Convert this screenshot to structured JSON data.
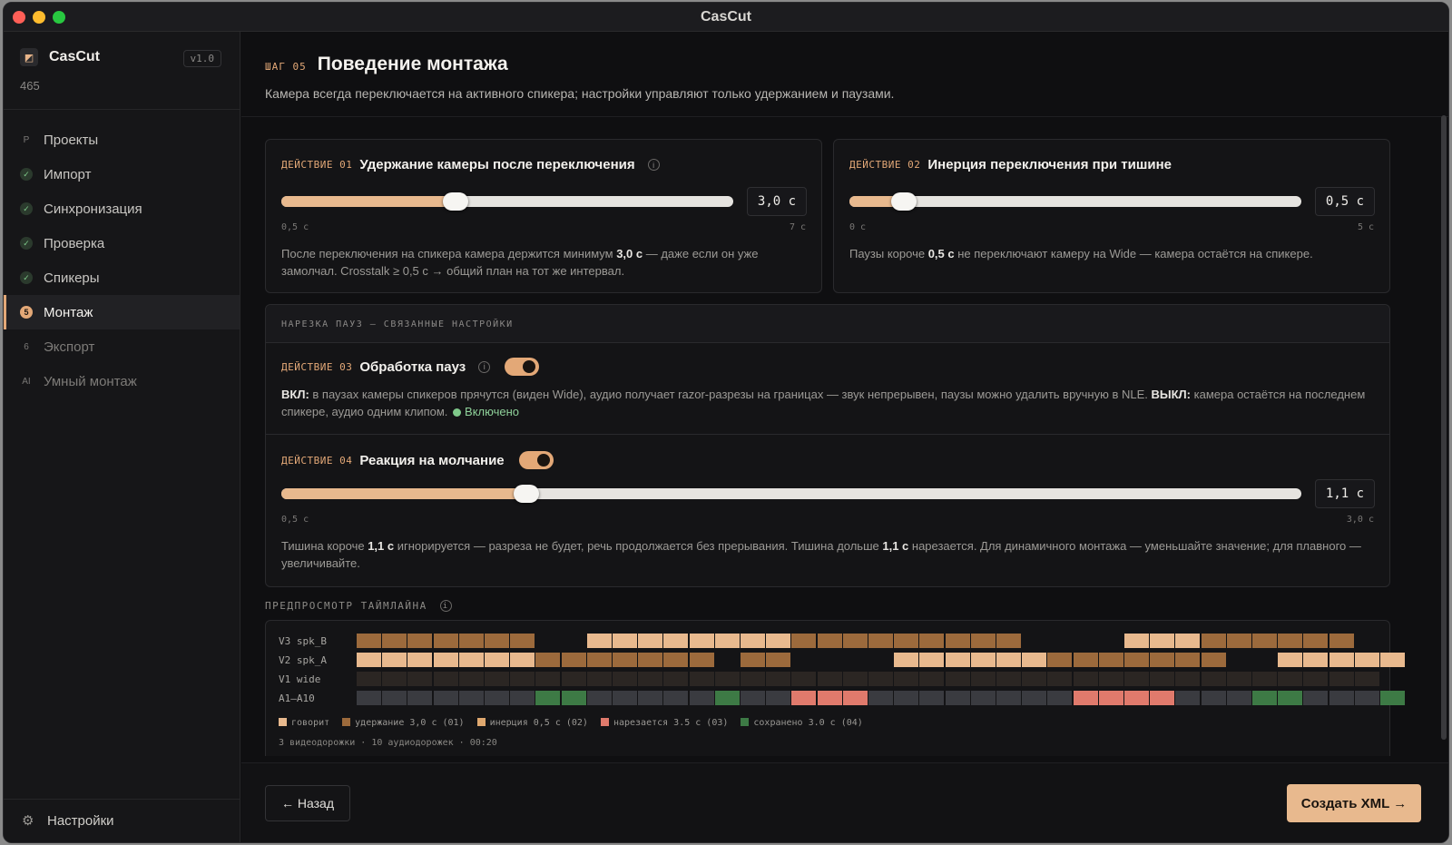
{
  "window": {
    "title": "CasCut"
  },
  "brand": {
    "name": "CasCut",
    "version": "v1.0",
    "subtitle": "465",
    "logo_icon": "clapper-icon"
  },
  "sidebar": {
    "items": [
      {
        "label": "Проекты",
        "icon": "P",
        "state": "pending"
      },
      {
        "label": "Импорт",
        "icon": "✓",
        "state": "done"
      },
      {
        "label": "Синхронизация",
        "icon": "✓",
        "state": "done"
      },
      {
        "label": "Проверка",
        "icon": "✓",
        "state": "done"
      },
      {
        "label": "Спикеры",
        "icon": "✓",
        "state": "done"
      },
      {
        "label": "Монтаж",
        "icon": "5",
        "state": "active"
      },
      {
        "label": "Экспорт",
        "icon": "6",
        "state": "pending"
      },
      {
        "label": "Умный монтаж",
        "icon": "AI",
        "state": "pending"
      }
    ],
    "settings_label": "Настройки"
  },
  "header": {
    "step_tag": "ШАГ 05",
    "title": "Поведение монтажа",
    "description": "Камера всегда переключается на активного спикера; настройки управляют только удержанием и паузами."
  },
  "action1": {
    "tag": "ДЕЙСТВИЕ 01",
    "title": "Удержание камеры после переключения",
    "value": "3,0 с",
    "level": 0.385,
    "min": "0,5 с",
    "max": "7 с",
    "desc_a": "После переключения на спикера камера держится минимум ",
    "desc_b": "3,0 с",
    "desc_c": " — даже если он уже замолчал. Crosstalk ≥ 0,5 с → общий план на тот же интервал."
  },
  "action2": {
    "tag": "ДЕЙСТВИЕ 02",
    "title": "Инерция переключения при тишине",
    "value": "0,5 с",
    "level": 0.12,
    "min": "0 с",
    "max": "5 с",
    "desc_a": "Паузы короче ",
    "desc_b": "0,5 с",
    "desc_c": " не переключают камеру на Wide — камера остаётся на спикере."
  },
  "pauses_section": {
    "heading": "НАРЕЗКА ПАУЗ — СВЯЗАННЫЕ НАСТРОЙКИ"
  },
  "action3": {
    "tag": "ДЕЙСТВИЕ 03",
    "title": "Обработка пауз",
    "toggle_on": true,
    "desc_on_label": "ВКЛ:",
    "desc_on": " в паузах камеры спикеров прячутся (виден Wide), аудио получает razor-разрезы на границах — звук непрерывен, паузы можно удалить вручную в NLE. ",
    "desc_off_label": "ВЫКЛ:",
    "desc_off": " камера остаётся на последнем спикере, аудио одним клипом.",
    "status": "Включено"
  },
  "action4": {
    "tag": "ДЕЙСТВИЕ 04",
    "title": "Реакция на молчание",
    "toggle_on": true,
    "value": "1,1 с",
    "level": 0.24,
    "min": "0,5 с",
    "max": "3,0 с",
    "desc_a": "Тишина короче ",
    "desc_b": "1,1 с",
    "desc_c": " игнорируется — разреза не будет, речь продолжается без прерывания. Тишина дольше ",
    "desc_d": "1,1 с",
    "desc_e": " нарезается. Для динамичного монтажа — уменьшайте значение; для плавного — увеличивайте."
  },
  "timeline": {
    "label": "ПРЕДПРОСМОТР ТАЙМЛАЙНА",
    "tracks": [
      {
        "name": "V3 spk_B",
        "cells": "HHHHHHH..SSSSSSSSHHHHHHHHH....SSSHHHHHH."
      },
      {
        "name": "V2 spk_A",
        "cells": "SSSSSSSHHHHHHH.HH....SSSSSSHHHHHHH..SSSSS"
      },
      {
        "name": "V1 wide",
        "cells": "WWWWWWWWWWWWWWWWWWWWWWWWWWWWWWWWWWWWWWWW"
      },
      {
        "name": "A1–A10",
        "cells": "AAAAAAAKKAAAAAKAACCCAAAAAAAACCCCAAAKKAAAK"
      }
    ],
    "colors": {
      "S": "#e8b98e",
      "H": "#9c6a3c",
      "I": "#dfa86f",
      "C": "#e07a6c",
      "K": "#3d7a45",
      "W": "#2b2623",
      "A": "#3a3b40"
    },
    "legend": [
      {
        "label": "говорит",
        "color": "#e8b98e"
      },
      {
        "label": "удержание 3,0 с (01)",
        "color": "#9c6a3c"
      },
      {
        "label": "инерция 0,5 с (02)",
        "color": "#dfa86f"
      },
      {
        "label": "нарезается 3.5 с (03)",
        "color": "#e07a6c"
      },
      {
        "label": "сохранено 3.0 с (04)",
        "color": "#3d7a45"
      }
    ],
    "footer": "3 видеодорожки · 10 аудиодорожек · 00:20"
  },
  "footer": {
    "back_label": "← Назад",
    "create_label": "Создать XML →"
  }
}
